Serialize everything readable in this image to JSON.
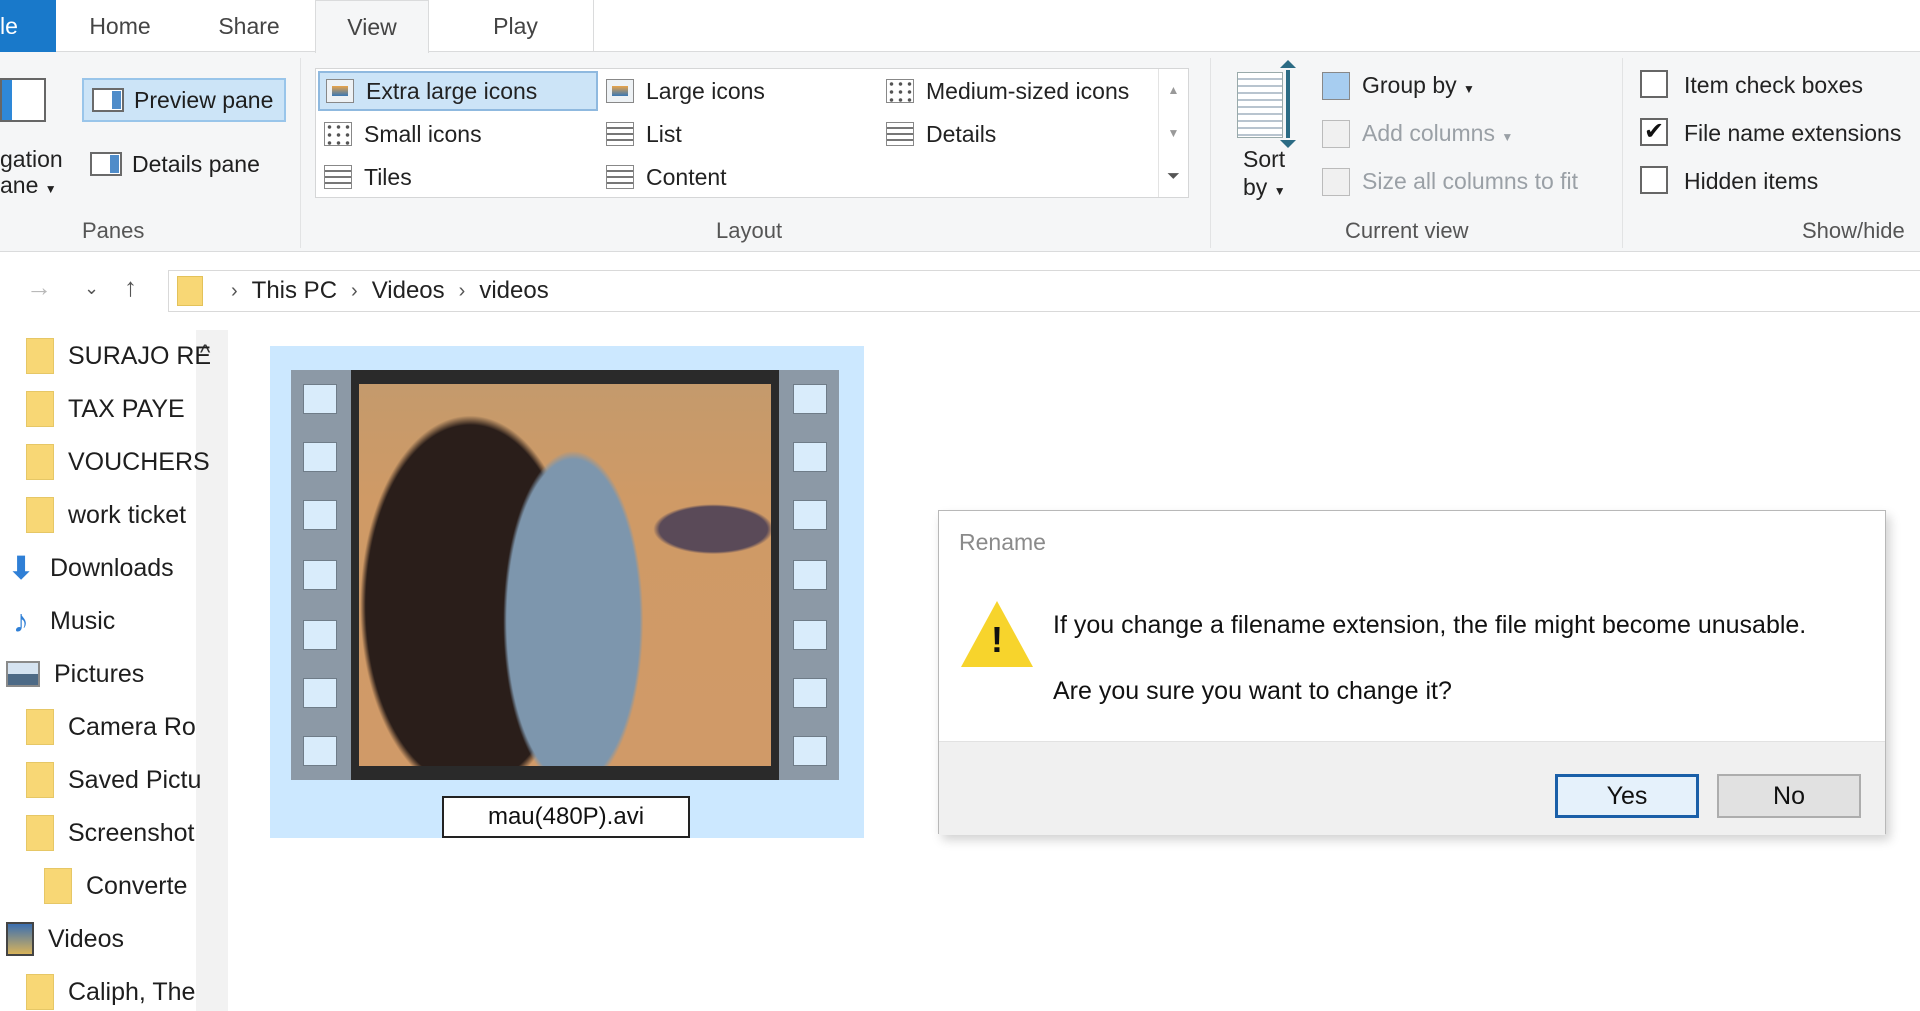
{
  "ribbon": {
    "tabs": [
      {
        "label": "le"
      },
      {
        "label": "Home"
      },
      {
        "label": "Share"
      },
      {
        "label": "View"
      },
      {
        "label": "Play"
      }
    ],
    "panes": {
      "navigation_pane_line1": "gation",
      "navigation_pane_line2": "ane",
      "preview_pane": "Preview pane",
      "details_pane": "Details pane",
      "group_label": "Panes"
    },
    "layout": {
      "items": [
        {
          "label": "Extra large icons",
          "selected": true
        },
        {
          "label": "Large icons"
        },
        {
          "label": "Medium-sized icons"
        },
        {
          "label": "Small icons"
        },
        {
          "label": "List"
        },
        {
          "label": "Details"
        },
        {
          "label": "Tiles"
        },
        {
          "label": "Content"
        }
      ],
      "group_label": "Layout"
    },
    "current_view": {
      "sort_by_line1": "Sort",
      "sort_by_line2": "by",
      "group_by": "Group by",
      "add_columns": "Add columns",
      "size_columns": "Size all columns to fit",
      "group_label": "Current view"
    },
    "show_hide": {
      "item_check_boxes": {
        "label": "Item check boxes",
        "checked": false
      },
      "file_name_extensions": {
        "label": "File name extensions",
        "checked": true
      },
      "hidden_items": {
        "label": "Hidden items",
        "checked": false
      },
      "group_label": "Show/hide"
    }
  },
  "address": {
    "breadcrumb": [
      "This PC",
      "Videos",
      "videos"
    ],
    "separator": "›"
  },
  "sidebar": {
    "items": [
      {
        "label": "SURAJO RE",
        "icon": "folder-icon"
      },
      {
        "label": "TAX PAYE",
        "icon": "folder-icon"
      },
      {
        "label": "VOUCHERS",
        "icon": "folder-icon"
      },
      {
        "label": "work ticket",
        "icon": "folder-icon"
      },
      {
        "label": "Downloads",
        "icon": "download-icon"
      },
      {
        "label": "Music",
        "icon": "music-icon"
      },
      {
        "label": "Pictures",
        "icon": "pictures-icon"
      },
      {
        "label": "Camera Ro",
        "icon": "folder-icon"
      },
      {
        "label": "Saved Pictu",
        "icon": "folder-icon"
      },
      {
        "label": "Screenshot",
        "icon": "folder-icon"
      },
      {
        "label": "Converte",
        "icon": "folder-icon"
      },
      {
        "label": "Videos",
        "icon": "videos-icon"
      },
      {
        "label": "Caliph, The",
        "icon": "folder-icon"
      }
    ]
  },
  "file": {
    "name": "mau(480P).avi",
    "selected": true,
    "renaming": true
  },
  "dialog": {
    "title": "Rename",
    "message_line1": "If you change a filename extension, the file might become unusable.",
    "message_line2": "Are you sure you want to change it?",
    "yes_label": "Yes",
    "no_label": "No",
    "icon": "warning-icon"
  },
  "colors": {
    "accent": "#1979ca",
    "selection": "#cce8ff",
    "warning": "#f7d42c"
  }
}
